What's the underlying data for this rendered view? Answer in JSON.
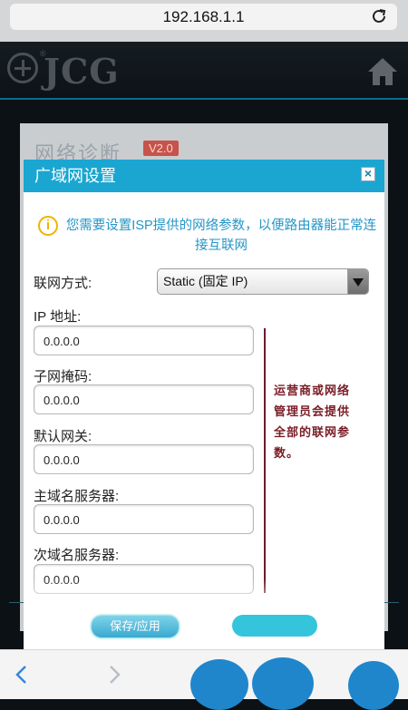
{
  "browser": {
    "url": "192.168.1.1",
    "reload_icon": "reload-icon",
    "back_icon": "chevron-left-icon",
    "forward_icon": "chevron-right-icon"
  },
  "header": {
    "logo_text": "JCG",
    "logo_registered": "®",
    "home_icon": "home-icon"
  },
  "background_page": {
    "title": "网络诊断",
    "version_badge": "V2.0"
  },
  "modal": {
    "title": "广域网设置",
    "close_label": "×",
    "notice": "您需要设置ISP提供的网络参数，以便路由器能正常连接互联网",
    "connection_type_label": "联网方式:",
    "connection_type_value": "Static (固定 IP)",
    "fields": [
      {
        "label": "IP 地址:",
        "value": "0.0.0.0"
      },
      {
        "label": "子网掩码:",
        "value": "0.0.0.0"
      },
      {
        "label": "默认网关:",
        "value": "0.0.0.0"
      },
      {
        "label": "主域名服务器:",
        "value": "0.0.0.0"
      },
      {
        "label": "次域名服务器:",
        "value": "0.0.0.0"
      }
    ],
    "side_note": "运营商或网络管理员会提供全部的联网参数。",
    "save_button": "保存/应用",
    "colors": {
      "header": "#1aa6d1",
      "notice_text": "#2596c7",
      "annotation": "#7a1d26"
    }
  }
}
